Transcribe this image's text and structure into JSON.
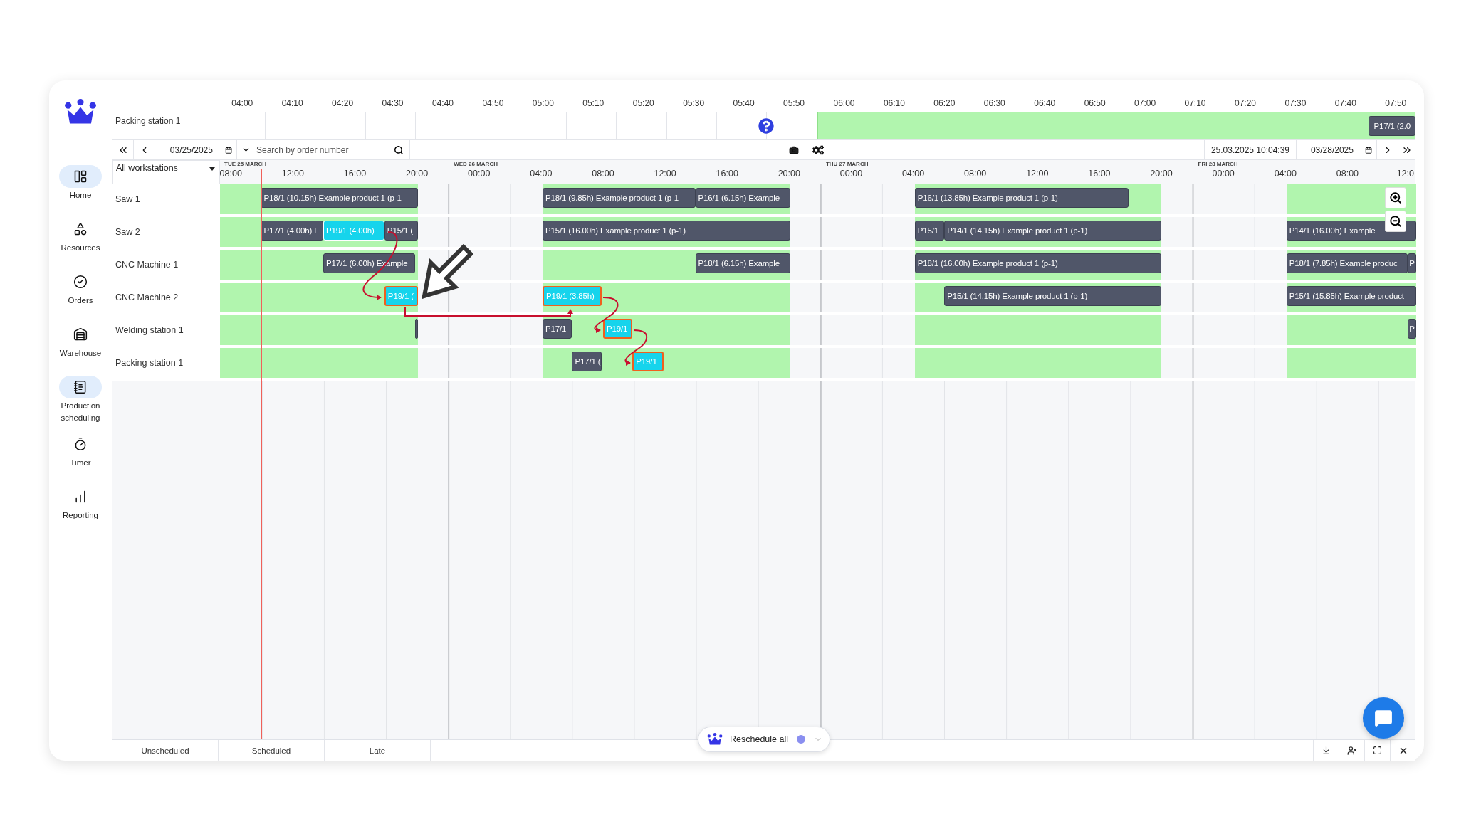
{
  "sidebar": {
    "items": [
      {
        "label": "Home",
        "selected": true
      },
      {
        "label": "Resources",
        "selected": false
      },
      {
        "label": "Orders",
        "selected": false
      },
      {
        "label": "Warehouse",
        "selected": false
      },
      {
        "label": "Production scheduling",
        "selected": true
      },
      {
        "label": "Timer",
        "selected": false
      },
      {
        "label": "Reporting",
        "selected": false
      }
    ]
  },
  "top_timeline": {
    "ticks": [
      "04:00",
      "04:10",
      "04:20",
      "04:30",
      "04:40",
      "04:50",
      "05:00",
      "05:10",
      "05:20",
      "05:30",
      "05:40",
      "05:50",
      "06:00",
      "06:10",
      "06:20",
      "06:30",
      "06:40",
      "06:50",
      "07:00",
      "07:10",
      "07:20",
      "07:30",
      "07:40",
      "07:50"
    ],
    "row": {
      "label": "Packing station 1",
      "task": "P17/1 (2.0"
    }
  },
  "toolbar": {
    "start_date": "03/25/2025",
    "search": {
      "placeholder": "Search by order number"
    },
    "current_time": "25.03.2025 10:04:39",
    "end_date": "03/28/2025"
  },
  "workstation_filter": "All workstations",
  "time_scale": {
    "days": [
      {
        "label": "TUE 25 MARCH",
        "hours": [
          "08:00",
          "12:00",
          "16:00",
          "20:00"
        ]
      },
      {
        "label": "WED 26 MARCH",
        "hours": [
          "00:00",
          "04:00",
          "08:00",
          "12:00",
          "16:00",
          "20:00"
        ]
      },
      {
        "label": "THU 27 MARCH",
        "hours": [
          "00:00",
          "04:00",
          "08:00",
          "12:00",
          "16:00",
          "20:00"
        ]
      },
      {
        "label": "FRI 28 MARCH",
        "hours": [
          "00:00",
          "04:00",
          "08:00",
          "12:0"
        ]
      }
    ]
  },
  "rows": [
    {
      "name": "Saw 1",
      "tasks": [
        {
          "label": "P18/1 (10.15h) Example product 1 (p-1",
          "kind": "scheduled"
        },
        {
          "label": "P18/1 (9.85h) Example product 1 (p-1",
          "kind": "scheduled"
        },
        {
          "label": "P16/1 (6.15h) Example",
          "kind": "scheduled"
        },
        {
          "label": "P16/1 (13.85h) Example product 1 (p-1)",
          "kind": "scheduled"
        }
      ]
    },
    {
      "name": "Saw 2",
      "tasks": [
        {
          "label": "P17/1 (4.00h) E",
          "kind": "scheduled"
        },
        {
          "label": "P19/1 (4.00h)",
          "kind": "highlighted"
        },
        {
          "label": "P15/1 (",
          "kind": "scheduled"
        },
        {
          "label": "P15/1 (16.00h) Example product 1 (p-1)",
          "kind": "scheduled"
        },
        {
          "label": "P15/1",
          "kind": "scheduled"
        },
        {
          "label": "P14/1 (14.15h) Example product 1 (p-1)",
          "kind": "scheduled"
        },
        {
          "label": "P14/1 (16.00h) Example",
          "kind": "scheduled"
        }
      ]
    },
    {
      "name": "CNC Machine 1",
      "tasks": [
        {
          "label": "P17/1 (6.00h) Example",
          "kind": "scheduled"
        },
        {
          "label": "P18/1 (6.15h) Example",
          "kind": "scheduled"
        },
        {
          "label": "P18/1 (16.00h) Example product 1 (p-1)",
          "kind": "scheduled"
        },
        {
          "label": "P18/1 (7.85h) Example produc",
          "kind": "scheduled"
        },
        {
          "label": "P",
          "kind": "scheduled"
        }
      ]
    },
    {
      "name": "CNC Machine 2",
      "tasks": [
        {
          "label": "P19/1 (",
          "kind": "selected"
        },
        {
          "label": "P19/1 (3.85h)",
          "kind": "selected"
        },
        {
          "label": "P15/1 (14.15h) Example product 1 (p-1)",
          "kind": "scheduled"
        },
        {
          "label": "P15/1 (15.85h) Example product",
          "kind": "scheduled"
        }
      ]
    },
    {
      "name": "Welding station 1",
      "tasks": [
        {
          "kind": "scheduled"
        },
        {
          "label": "P17/1",
          "kind": "scheduled"
        },
        {
          "label": "P19/1",
          "kind": "selected"
        },
        {
          "label": "P",
          "kind": "scheduled"
        }
      ]
    },
    {
      "name": "Packing station 1",
      "tasks": [
        {
          "label": "P17/1 (",
          "kind": "scheduled"
        },
        {
          "label": "P19/1",
          "kind": "selected"
        }
      ]
    }
  ],
  "bottom_tabs": [
    "Unscheduled",
    "Scheduled",
    "Late"
  ],
  "reschedule_button": "Reschedule all"
}
